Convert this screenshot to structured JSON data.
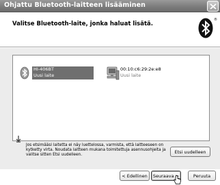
{
  "window": {
    "title": "Ohjattu Bluetooth-laitteen lisääminen",
    "close_label": "X"
  },
  "header": {
    "instruction": "Valitse Bluetooth-laite, jonka haluat lisätä."
  },
  "devices": [
    {
      "name": "HI-406BT",
      "status": "Uusi laite",
      "icon": "bluetooth-device-icon",
      "selected": true
    },
    {
      "name": "00:10:c6:29:2e:e8",
      "status": "Uusi laite",
      "icon": "computer-icon",
      "selected": false
    }
  ],
  "hint": {
    "text": "Jos etsimääsi laitetta ei näy luettelossa, varmista, että laitteeseen on kytketty virta. Noudata laitteen mukana toimitettuja asennusohjeita ja valitse sitten Etsi uudelleen.",
    "icon": "info-icon"
  },
  "buttons": {
    "rescan": "Etsi uudelleen",
    "back": "< Edellinen",
    "next": "Seuraava >",
    "cancel": "Peruuta"
  },
  "colors": {
    "selection": "#6f6f6f",
    "titlebar": "#7d7d7d"
  }
}
